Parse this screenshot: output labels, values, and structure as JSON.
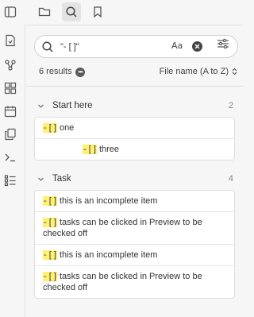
{
  "toolbar": {
    "tabs": [
      {
        "name": "sidebar-toggle",
        "icon": "sidebar-toggle-icon"
      },
      {
        "name": "files",
        "icon": "folder-icon"
      },
      {
        "name": "search",
        "icon": "search-icon",
        "active": true
      },
      {
        "name": "bookmarks",
        "icon": "bookmark-icon"
      }
    ]
  },
  "ribbon": {
    "icons": [
      "file-icon",
      "graph-icon",
      "canvas-icon",
      "calendar-icon",
      "copy-icon",
      "terminal-icon",
      "list-icon"
    ]
  },
  "search": {
    "query": "\"- [ ]\"",
    "match_case_label": "Aa",
    "results_text": "6 results",
    "sort_label": "File name (A to Z)"
  },
  "groups": [
    {
      "title": "Start here",
      "count": "2",
      "matches": [
        {
          "prefix": "- [ ]",
          "text": " one",
          "indent": false
        },
        {
          "prefix": "- [ ]",
          "text": " three",
          "indent": true
        }
      ]
    },
    {
      "title": "Task",
      "count": "4",
      "matches": [
        {
          "prefix": "- [ ]",
          "text": " this is an incomplete item",
          "indent": false
        },
        {
          "prefix": "- [ ]",
          "text": " tasks can be clicked in Preview to be checked off",
          "indent": false
        },
        {
          "prefix": "- [ ]",
          "text": " this is an incomplete item",
          "indent": false
        },
        {
          "prefix": "- [ ]",
          "text": " tasks can be clicked in Preview to be checked off",
          "indent": false
        }
      ]
    }
  ],
  "colors": {
    "highlight": "#fff071",
    "background": "#f6f6f6",
    "card": "#ffffff"
  }
}
